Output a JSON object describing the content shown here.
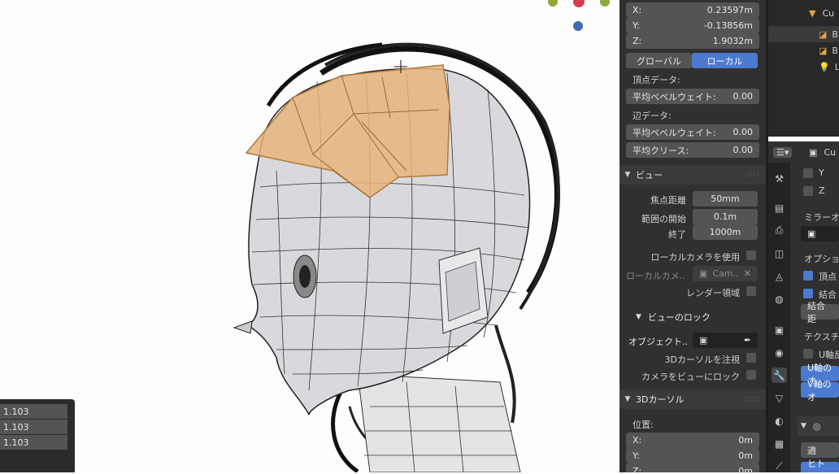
{
  "item": {
    "x_label": "X:",
    "x_value": "0.23597m",
    "y_label": "Y:",
    "y_value": "-0.13856m",
    "z_label": "Z:",
    "z_value": "1.9032m",
    "global_label": "グローバル",
    "local_label": "ローカル",
    "vertex_data_label": "頂点データ:",
    "vertex_bevel_label": "平均ベベルウェイト:",
    "vertex_bevel_value": "0.00",
    "edge_data_label": "辺データ:",
    "edge_bevel_label": "平均ベベルウェイト:",
    "edge_bevel_value": "0.00",
    "crease_label": "平均クリース:",
    "crease_value": "0.00"
  },
  "view": {
    "title": "ビュー",
    "focal_label": "焦点距離",
    "focal_value": "50mm",
    "clip_start_label": "範囲の開始",
    "clip_start_value": "0.1m",
    "clip_end_label": "終了",
    "clip_end_value": "1000m",
    "local_camera_label": "ローカルカメラを使用",
    "local_camera_field_label": "ローカルカメ..",
    "camera_value": "Cam..",
    "render_region_label": "レンダー領域",
    "lock_title": "ビューのロック",
    "object_label": "オブジェクト..",
    "lock_cursor_label": "3Dカーソルを注視",
    "lock_camera_label": "カメラをビューにロック"
  },
  "cursor3d": {
    "title": "3Dカーソル",
    "location_label": "位置:",
    "x_label": "X:",
    "x_value": "0m",
    "y_label": "Y:",
    "y_value": "0m",
    "z_label": "Z:",
    "z_value": "0m"
  },
  "redo_panel": {
    "values": [
      "1.103",
      "1.103",
      "1.103"
    ]
  },
  "outliner": {
    "items": [
      "Cu",
      "B",
      "B",
      "L"
    ]
  },
  "properties": {
    "object_name": "Cu",
    "axis_y": "Y",
    "axis_z": "Z",
    "mirror_label": "ミラーオ",
    "options_label": "オプショ",
    "vertex_label": "頂点",
    "merge_label": "結合",
    "merge_dist_label": "結合距",
    "texture_label": "テクスチ",
    "u_axis_label": "U軸反",
    "u_offset_label": "U軸のオ",
    "v_offset_label": "V軸のオ",
    "bottom_btn1": "適",
    "bottom_btn2": "ヒトアル"
  },
  "colors": {
    "accent_blue": "#4b7ad1",
    "selected_face": "#e8b57c",
    "panel_bg": "#303030",
    "field_bg": "#545454"
  }
}
